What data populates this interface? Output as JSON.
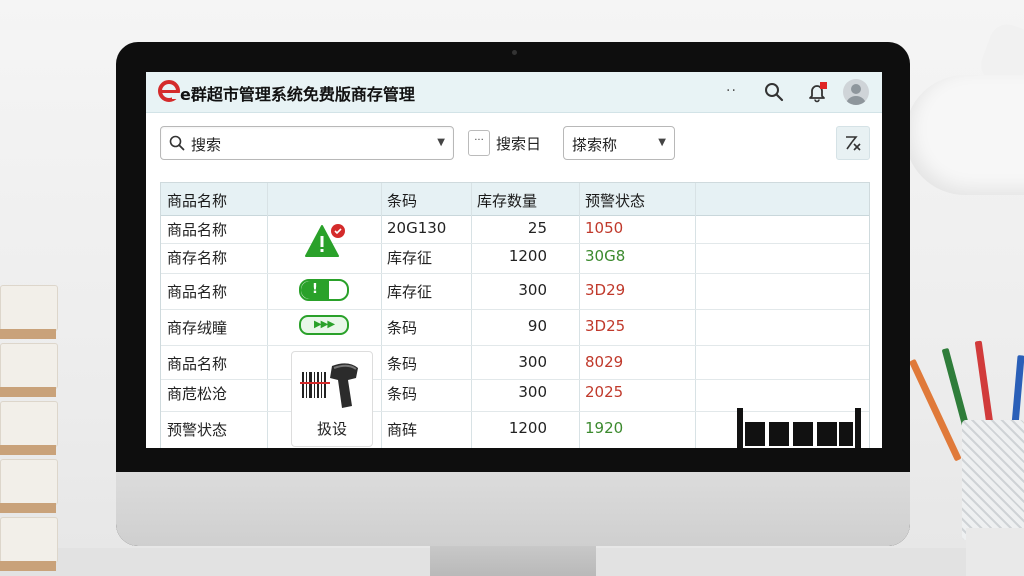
{
  "app": {
    "title": "e群超市管理系统免费版商存管理",
    "logo_letter": "e",
    "accent": "#d42b2b"
  },
  "topbar": {
    "more_icon": "more-dots-icon",
    "more_glyph": "··",
    "search_icon": "search-icon",
    "bell_icon": "bell-icon",
    "avatar_icon": "user-avatar-icon"
  },
  "search": {
    "value": "搜索",
    "date_button_glyph": "···",
    "date_label": "搜索日",
    "select_value": "搽索称",
    "filter_icon": "filter-clear-icon"
  },
  "table": {
    "headers": [
      "商品名称",
      "",
      "条码",
      "库存数量",
      "预警状态"
    ],
    "rows": [
      {
        "name": "商品名称",
        "code": "20G130",
        "qty": "25",
        "status": "1050",
        "status_color": "#c0392b"
      },
      {
        "name": "商存名称",
        "code": "库存征",
        "qty": "1200",
        "status": "30G8",
        "status_color": "#3c8a2e"
      },
      {
        "name": "商品名称",
        "code": "库存征",
        "qty": "300",
        "status": "3D29",
        "status_color": "#c0392b"
      },
      {
        "name": "商存绒瞳",
        "code": "条码",
        "qty": "90",
        "status": "3D25",
        "status_color": "#c0392b"
      },
      {
        "name": "商品名称",
        "code": "条码",
        "qty": "300",
        "status": "8029",
        "status_color": "#c0392b"
      },
      {
        "name": "商苊松沧",
        "code": "条码",
        "qty": "300",
        "status": "2025",
        "status_color": "#c0392b"
      },
      {
        "name": "预警状态",
        "code": "商砗",
        "qty": "1200",
        "status": "1920",
        "status_color": "#3c8a2e"
      }
    ],
    "indicators": {
      "warning_icon": "warning-triangle-icon",
      "toggle_label": "!",
      "progress_label": "▶▶▶",
      "scanner_icon": "barcode-scanner-icon",
      "scanner_label": "扱设",
      "shelf_icon": "warehouse-shelf-icon"
    }
  },
  "colors": {
    "header_bg": "#e6f1f4",
    "ok_green": "#2aa12a",
    "warn_red": "#d42b2b"
  }
}
